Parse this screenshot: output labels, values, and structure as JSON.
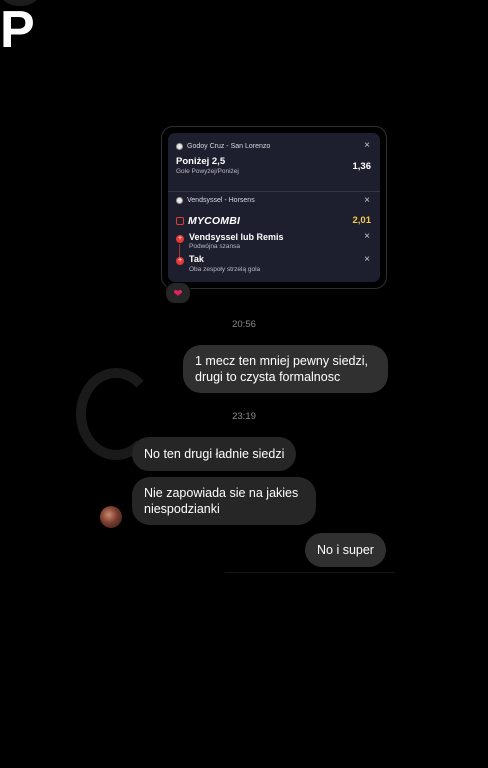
{
  "bet_slip": {
    "match1": "Godoy Cruz - San Lorenzo",
    "pick1_title": "Poniżej 2,5",
    "pick1_sub": "Gole Powyżej/Poniżej",
    "pick1_odds": "1,36",
    "match2": "Vendsyssel - Horsens",
    "combi_label": "MYCOMBI",
    "combi_odds": "2,01",
    "pick2_title": "Vendsyssel lub Remis",
    "pick2_sub": "Podwójna szansa",
    "pick3_title": "Tak",
    "pick3_sub": "Oba zespoły strzelą gola",
    "close_glyph": "×",
    "plus_glyph": "+"
  },
  "reaction": "❤",
  "time1": "20:56",
  "msg_out_1": "1 mecz ten mniej pewny siedzi, drugi to czysta formalnosc",
  "time2": "23:19",
  "msg_in_1": "No ten drugi ładnie siedzi",
  "msg_in_2": "Nie zapowiada sie na jakies niespodzianki",
  "msg_out_2": "No i super",
  "colors": {
    "accent_red": "#e53935",
    "odds_gold": "#f2c94c",
    "bubble": "#262626"
  }
}
